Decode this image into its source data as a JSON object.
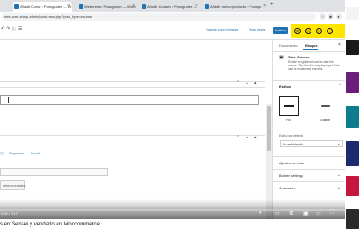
{
  "browser": {
    "tabs": [
      {
        "label": "Añadir Curso ‹ Ponsgunter — W"
      },
      {
        "label": "Webpress ‹ Ponsgunter — Word"
      },
      {
        "label": "Añadir Usuario ‹ Ponsgunter —"
      },
      {
        "label": "Añadir nuevo producto ‹ Ponsgu"
      }
    ],
    "url": "ntes.com.ar/wp-admin/post-new.php?post_type=course"
  },
  "editor": {
    "save_draft": "Guardar como borrador",
    "preview": "Vista previa",
    "publish": "Publicar",
    "tabs": [
      "Esquema",
      "Social"
    ],
    "select_label": "seleccionados"
  },
  "sidebar": {
    "tab_document": "Documento",
    "tab_block": "Bloque",
    "block_title": "Take Course",
    "block_desc": "Enable a registered user to start the course. This block is only displayed if the user is not already enrolled.",
    "styles_heading": "Estilos",
    "style_fill": "Fill",
    "style_outline": "Outline",
    "default_style_label": "Estilo por defecto",
    "default_style_value": "No establecido",
    "panels": [
      "Ajustes de color",
      "Border settings",
      "Avanzado"
    ]
  },
  "player": {
    "time": "0:00 / 7:17",
    "progress": 0.0
  },
  "caption": "s en Sensei y vendarlo en Woocommerce"
}
